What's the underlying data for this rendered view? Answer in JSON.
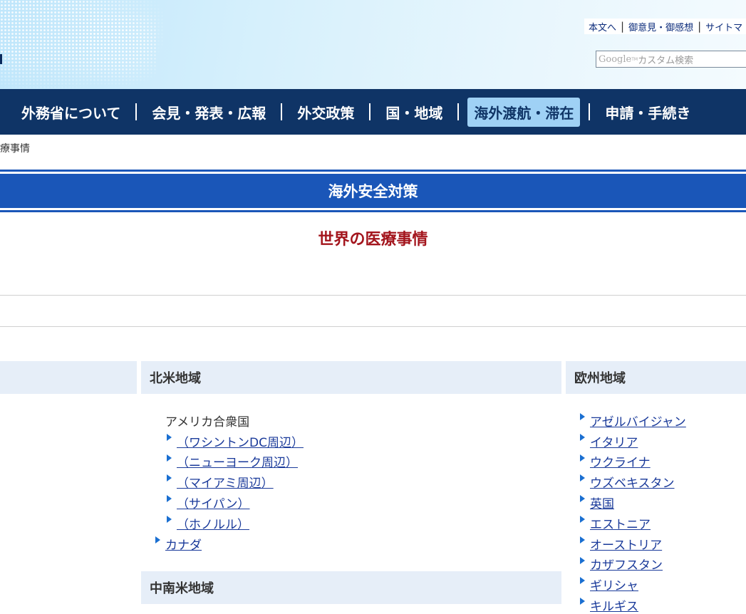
{
  "header": {
    "util_links": [
      "本文へ",
      "御意見・御感想",
      "サイトマ"
    ],
    "search_logo": "Google",
    "search_tm": "TM",
    "search_placeholder": "カスタム検索"
  },
  "nav": {
    "items": [
      {
        "label": "外務省について"
      },
      {
        "label": "会見・発表・広報"
      },
      {
        "label": "外交政策"
      },
      {
        "label": "国・地域"
      },
      {
        "label": "海外渡航・滞在",
        "active": true
      },
      {
        "label": "申請・手続き"
      }
    ]
  },
  "breadcrumb": "療事情",
  "banner": "海外安全対策",
  "page_title": "世界の医療事情",
  "regions": {
    "north_america": {
      "title": "北米地域",
      "country": "アメリカ合衆国",
      "us_links": [
        "（ワシントンDC周辺）",
        "（ニューヨーク周辺）",
        "（マイアミ周辺）",
        "（サイパン）",
        "（ホノルル）"
      ],
      "other_links": [
        "カナダ"
      ]
    },
    "central_south_america": {
      "title": "中南米地域"
    },
    "europe": {
      "title": "欧州地域",
      "links": [
        "アゼルバイジャン",
        "イタリア",
        "ウクライナ",
        "ウズベキスタン",
        "英国",
        "エストニア",
        "オーストリア",
        "カザフスタン",
        "ギリシャ",
        "キルギス"
      ]
    }
  },
  "colors": {
    "nav_bg": "#0f3466",
    "nav_active_bg": "#9fd1f5",
    "banner_bg": "#1a56b8",
    "title_red": "#a3151d",
    "region_head_bg": "#e6eef8",
    "link_blue": "#1a3a9a",
    "bullet_blue": "#1a6fd1"
  }
}
